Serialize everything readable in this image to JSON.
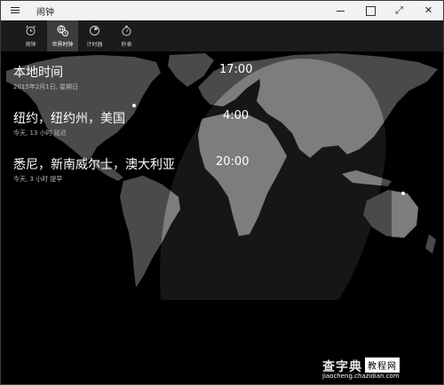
{
  "window": {
    "title": "闹钟",
    "icons": {
      "menu": "hamburger-icon",
      "minimize": "minimize-icon",
      "maximize": "maximize-icon",
      "fullscreen": "expand-icon",
      "close": "close-icon"
    },
    "full_label": "⤢",
    "close_label": "✕"
  },
  "tabs": [
    {
      "label": "闹钟",
      "icon": "alarm-clock-icon"
    },
    {
      "label": "世界时钟",
      "icon": "world-clock-icon"
    },
    {
      "label": "计时器",
      "icon": "timer-icon"
    },
    {
      "label": "秒表",
      "icon": "stopwatch-icon"
    }
  ],
  "active_tab": 1,
  "clocks": [
    {
      "city": "本地时间",
      "sub": "2015年2月1日, 星期日",
      "time": "17:00"
    },
    {
      "city": "纽约，纽约州，美国",
      "sub": "今天, 13 小时 延迟",
      "time": "4:00"
    },
    {
      "city": "悉尼，新南威尔士，澳大利亚",
      "sub": "今天, 3 小时 提早",
      "time": "20:00"
    }
  ],
  "watermark": {
    "title": "查字典",
    "box": "教程网",
    "url": "jiaocheng.chazidian.com"
  },
  "colors": {
    "titlebar_bg": "#f2f2f2",
    "tabbar_bg": "#1b1b1b",
    "active_tab_bg": "#3d3d3d",
    "land_night": "#4a4a4a",
    "land_day": "#7d7d7d",
    "day_zone": "#2e2e2e"
  }
}
